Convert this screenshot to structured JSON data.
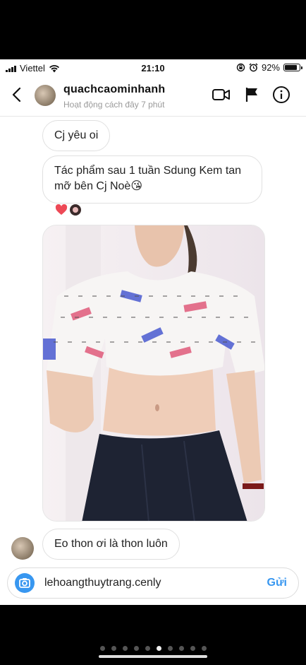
{
  "status_bar": {
    "carrier": "Viettel",
    "time": "21:10",
    "battery_text": "92%",
    "battery_level": 0.92,
    "icons": [
      "signal-icon",
      "wifi-icon",
      "orientation-lock-icon",
      "alarm-icon",
      "battery-icon"
    ]
  },
  "header": {
    "back_icon": "chevron-left-icon",
    "username": "quachcaominhanh",
    "activity": "Hoạt động cách đây 7 phút",
    "actions": [
      "video-call-icon",
      "flag-icon",
      "info-icon"
    ]
  },
  "messages": [
    {
      "type": "text",
      "text": "Cj yêu oi"
    },
    {
      "type": "text",
      "text": "Tác phẩm sau 1 tuần Sdung Kem tan mỡ bên Cj Noè😘"
    },
    {
      "type": "reactions",
      "items": [
        "heart-icon",
        "reactor-avatar"
      ]
    },
    {
      "type": "photo",
      "subject": "photo"
    },
    {
      "type": "text",
      "text": "Eo thon ơi là thon luôn"
    }
  ],
  "composer": {
    "value": "lehoangthuytrang.cenly",
    "send_label": "Gửi",
    "camera_icon": "camera-icon"
  },
  "page_indicator": {
    "count": 10,
    "active": 5
  },
  "colors": {
    "accent": "#3897f0",
    "heart": "#ed4956"
  }
}
